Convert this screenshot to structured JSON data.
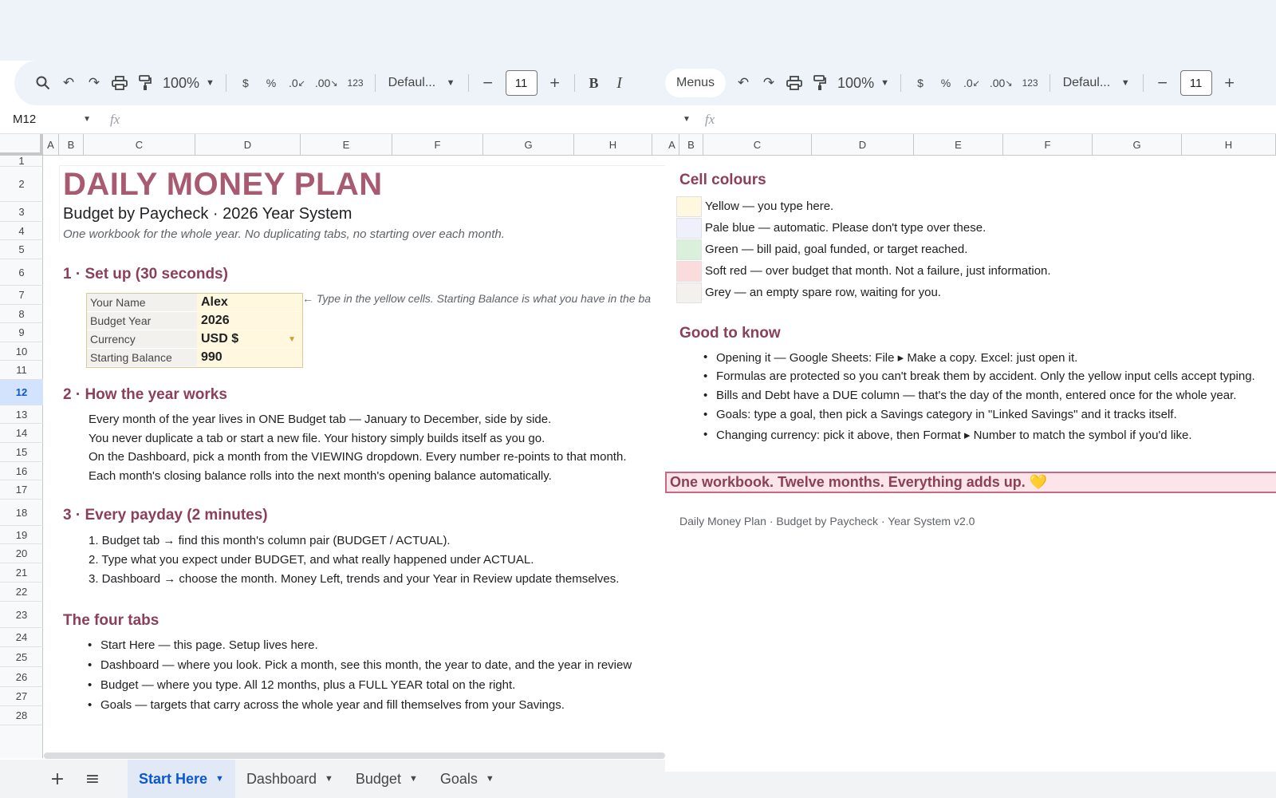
{
  "toolbar_left": {
    "zoom": "100%",
    "currency_btn": "$",
    "percent_btn": "%",
    "dec_decrease": ".0",
    "dec_increase": ".00",
    "format_btn": "123",
    "font": "Defaul...",
    "font_size": "11",
    "bold": "B",
    "italic": "I"
  },
  "toolbar_right": {
    "menus": "Menus",
    "zoom": "100%",
    "currency_btn": "$",
    "percent_btn": "%",
    "dec_decrease": ".0",
    "dec_increase": ".00",
    "format_btn": "123",
    "font": "Defaul...",
    "font_size": "11"
  },
  "formula_bar": {
    "name_box": "M12",
    "fx": "fx"
  },
  "columns_left": [
    "A",
    "B",
    "C",
    "D",
    "E",
    "F",
    "G",
    "H"
  ],
  "columns_right": [
    "A",
    "B",
    "C",
    "D",
    "E",
    "F",
    "G",
    "H"
  ],
  "rows": [
    "1",
    "2",
    "3",
    "4",
    "5",
    "6",
    "7",
    "8",
    "9",
    "10",
    "11",
    "12",
    "13",
    "14",
    "15",
    "16",
    "17",
    "18",
    "19",
    "20",
    "21",
    "22",
    "23",
    "24",
    "25",
    "26",
    "27",
    "28"
  ],
  "selected_row": "12",
  "left": {
    "title": "DAILY MONEY PLAN",
    "subtitle": "Budget by Paycheck  ·  2026 Year System",
    "tagline": "One workbook for the whole year. No duplicating tabs, no starting over each month.",
    "section1": "1 · Set up (30 seconds)",
    "setup": [
      {
        "label": "Your Name",
        "value": "Alex"
      },
      {
        "label": "Budget Year",
        "value": "2026"
      },
      {
        "label": "Currency",
        "value": "USD $"
      },
      {
        "label": "Starting Balance",
        "value": "990"
      }
    ],
    "setup_hint": "← Type in the yellow cells. Starting Balance is what you have in the ba",
    "section2": "2 · How the year works",
    "year_lines": [
      "Every month of the year lives in ONE Budget tab — January to December, side by side.",
      "You never duplicate a tab or start a new file. Your history simply builds itself as you go.",
      "On the Dashboard, pick a month from the VIEWING dropdown. Every number re-points to that month.",
      "Each month's closing balance rolls into the next month's opening balance automatically."
    ],
    "section3": "3 · Every payday (2 minutes)",
    "payday_steps": [
      "1.  Budget tab → find this month's column pair (BUDGET / ACTUAL).",
      "2.  Type what you expect under BUDGET, and what really happened under ACTUAL.",
      "3.  Dashboard → choose the month. Money Left, trends and your Year in Review update themselves."
    ],
    "section4": "The four tabs",
    "tab_bullets": [
      "Start Here — this page. Setup lives here.",
      "Dashboard — where you look. Pick a month, see this month, the year to date, and the year in review",
      "Budget — where you type. All 12 months, plus a FULL YEAR total on the right.",
      "Goals — targets that carry across the whole year and fill themselves from your Savings."
    ]
  },
  "right": {
    "cell_colours_title": "Cell colours",
    "legend": [
      {
        "color": "#fff7de",
        "text": "Yellow — you type here."
      },
      {
        "color": "#eef1fb",
        "text": "Pale blue — automatic. Please don't type over these."
      },
      {
        "color": "#daf0dc",
        "text": "Green — bill paid, goal funded, or target reached."
      },
      {
        "color": "#fbdcdc",
        "text": "Soft red — over budget that month. Not a failure, just information."
      },
      {
        "color": "#f3f1ee",
        "text": "Grey — an empty spare row, waiting for you."
      }
    ],
    "good_to_know_title": "Good to know",
    "good_to_know": [
      "Opening it — Google Sheets: File ▸ Make a copy.  Excel: just open it.",
      "Formulas are protected so you can't break them by accident. Only the yellow input cells accept typing.",
      "Bills and Debt have a DUE column — that's the day of the month, entered once for the whole year.",
      "Goals: type a goal, then pick a Savings category in \"Linked Savings\" and it tracks itself.",
      "Changing currency: pick it above, then Format ▸ Number to match the symbol if you'd like."
    ],
    "banner": "One workbook. Twelve months. Everything adds up. 💛",
    "footer": "Daily Money Plan  ·  Budget by Paycheck  ·  Year System v2.0"
  },
  "tabs": [
    {
      "label": "Start Here",
      "active": true
    },
    {
      "label": "Dashboard",
      "active": false
    },
    {
      "label": "Budget",
      "active": false
    },
    {
      "label": "Goals",
      "active": false
    }
  ]
}
